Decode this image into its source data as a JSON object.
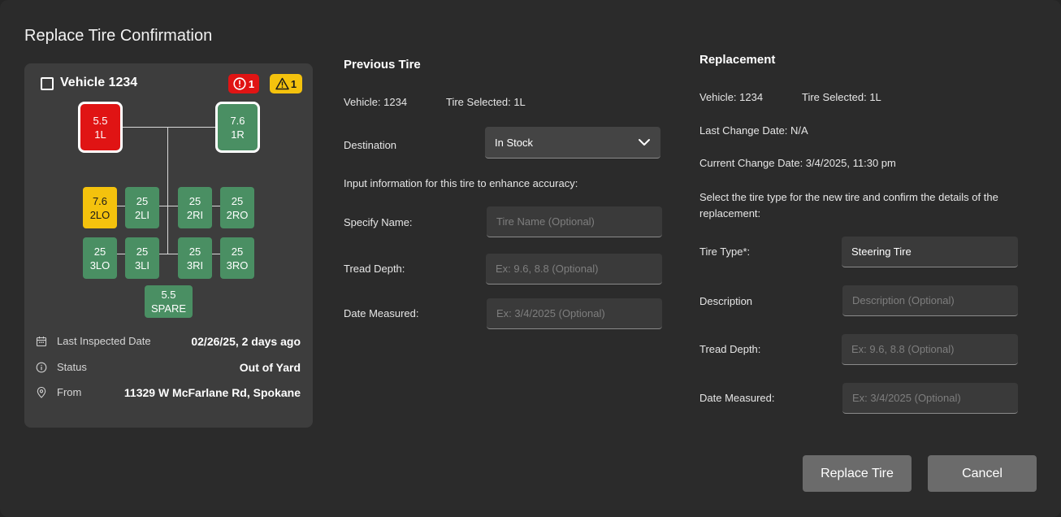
{
  "title": "Replace Tire Confirmation",
  "vehicle_card": {
    "name": "Vehicle 1234",
    "error_count": "1",
    "warning_count": "1",
    "colors": {
      "error": "#e01414",
      "warning": "#f4c20d",
      "ok": "#4a8f63"
    },
    "tires": [
      {
        "id": "1L",
        "depth": "5.5",
        "label": "1L",
        "status": "red",
        "selected": true
      },
      {
        "id": "1R",
        "depth": "7.6",
        "label": "1R",
        "status": "green",
        "selected": true
      },
      {
        "id": "2LO",
        "depth": "7.6",
        "label": "2LO",
        "status": "yellow"
      },
      {
        "id": "2LI",
        "depth": "25",
        "label": "2LI",
        "status": "green"
      },
      {
        "id": "2RI",
        "depth": "25",
        "label": "2RI",
        "status": "green"
      },
      {
        "id": "2RO",
        "depth": "25",
        "label": "2RO",
        "status": "green"
      },
      {
        "id": "3LO",
        "depth": "25",
        "label": "3LO",
        "status": "green"
      },
      {
        "id": "3LI",
        "depth": "25",
        "label": "3LI",
        "status": "green"
      },
      {
        "id": "3RI",
        "depth": "25",
        "label": "3RI",
        "status": "green"
      },
      {
        "id": "3RO",
        "depth": "25",
        "label": "3RO",
        "status": "green"
      },
      {
        "id": "SPARE",
        "depth": "5.5",
        "label": "SPARE",
        "status": "green"
      }
    ],
    "last_inspected_label": "Last Inspected Date",
    "last_inspected_value": "02/26/25, 2 days ago",
    "status_label": "Status",
    "status_value": "Out of Yard",
    "from_label": "From",
    "from_value": "11329 W McFarlane Rd, Spokane"
  },
  "previous": {
    "heading": "Previous Tire",
    "vehicle": "Vehicle: 1234",
    "tire_selected": "Tire Selected: 1L",
    "destination_label": "Destination",
    "destination_value": "In Stock",
    "hint": "Input information for this tire to enhance accuracy:",
    "name_label": "Specify Name:",
    "name_placeholder": "Tire Name (Optional)",
    "tread_label": "Tread Depth:",
    "tread_placeholder": "Ex: 9.6, 8.8 (Optional)",
    "date_label": "Date Measured:",
    "date_placeholder": "Ex: 3/4/2025 (Optional)"
  },
  "replacement": {
    "heading": "Replacement",
    "vehicle": "Vehicle: 1234",
    "tire_selected": "Tire Selected: 1L",
    "last_change": "Last Change Date: N/A",
    "current_change": "Current Change Date: 3/4/2025, 11:30 pm",
    "instructions": "Select the tire type for the new tire and confirm the details of the replacement:",
    "type_label": "Tire Type*:",
    "type_value": "Steering Tire",
    "desc_label": "Description",
    "desc_placeholder": "Description (Optional)",
    "tread_label": "Tread Depth:",
    "tread_placeholder": "Ex: 9.6, 8.8 (Optional)",
    "date_label": "Date Measured:",
    "date_placeholder": "Ex: 3/4/2025 (Optional)"
  },
  "buttons": {
    "replace": "Replace Tire",
    "cancel": "Cancel"
  }
}
